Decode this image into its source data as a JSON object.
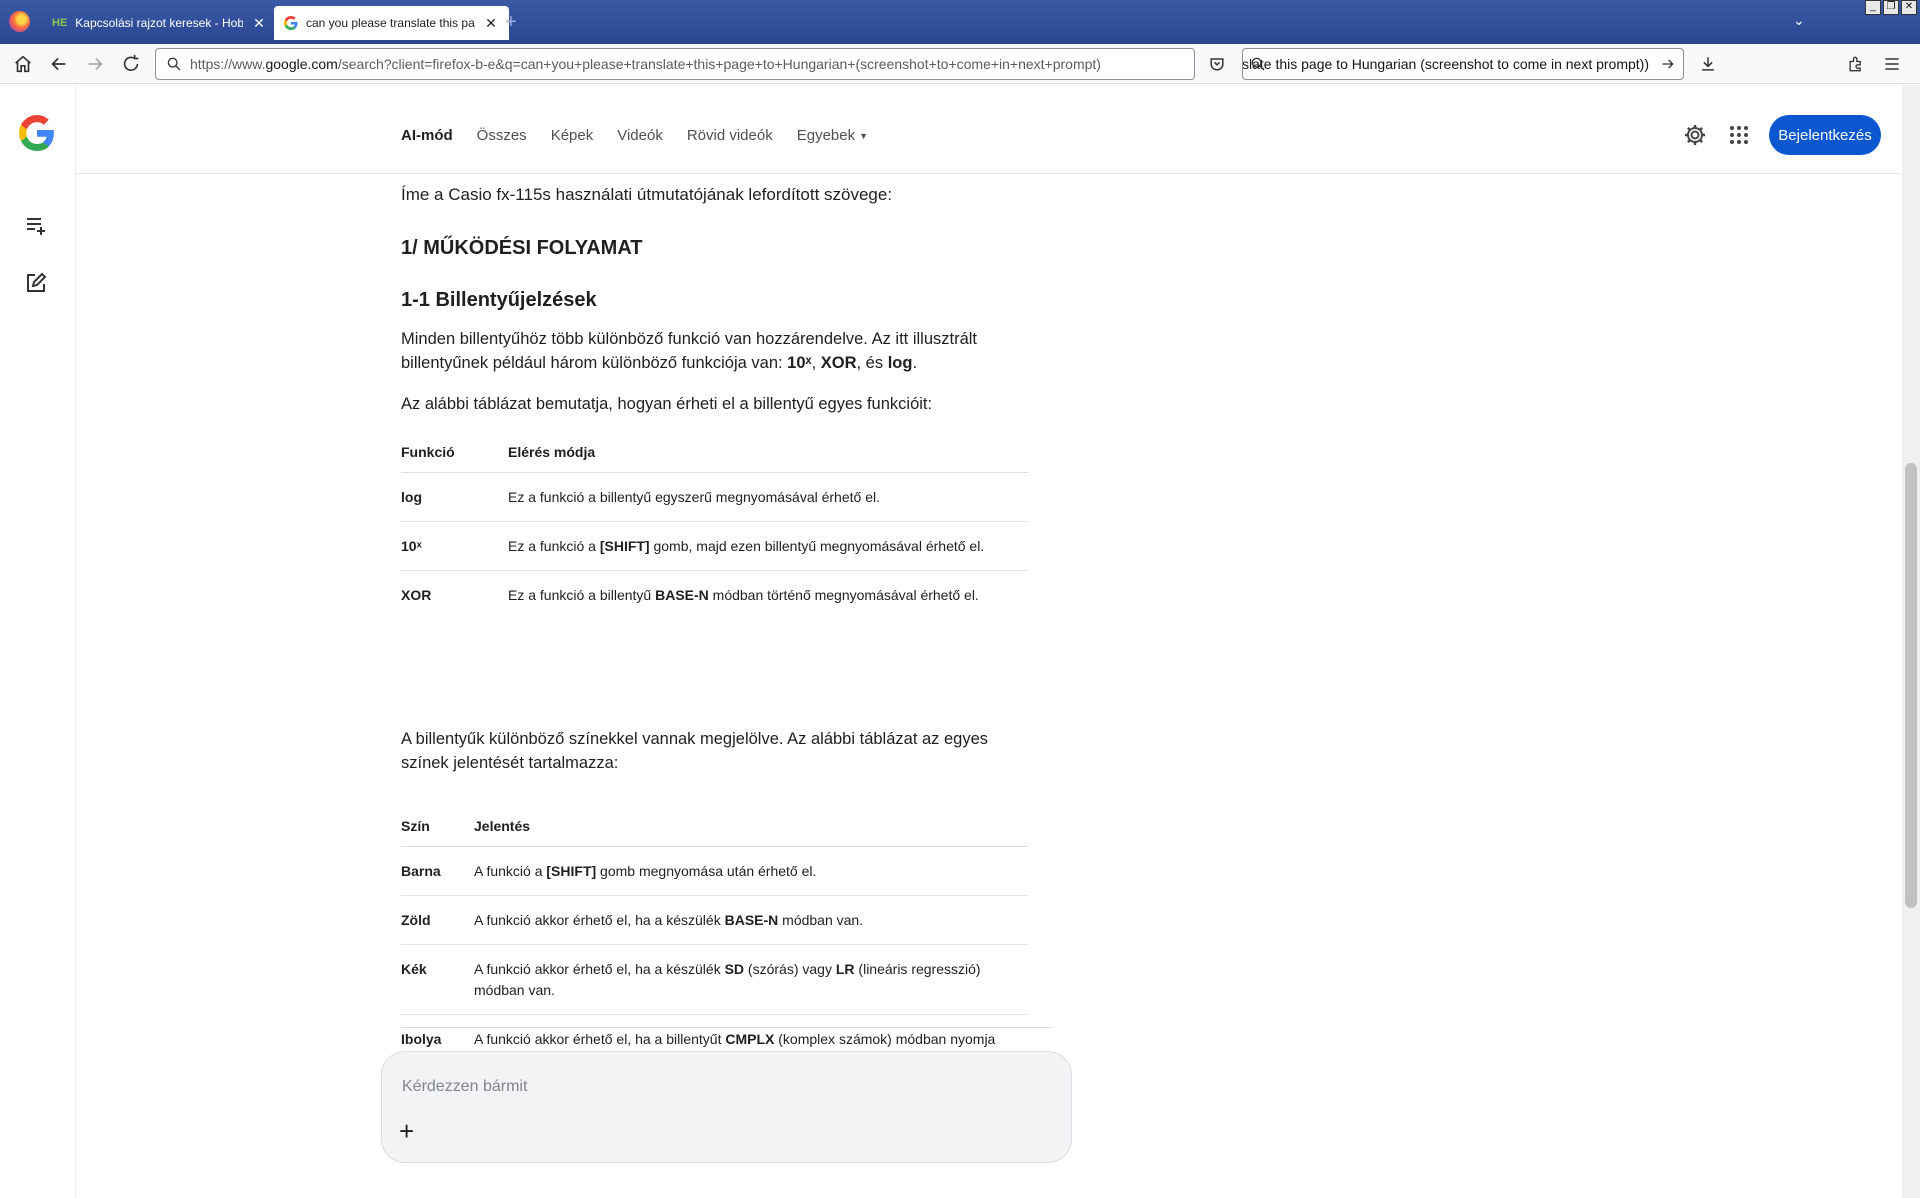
{
  "browser": {
    "tabs": [
      {
        "title": "Kapcsolási rajzot keresek - Hobbielektronika",
        "favicon": "HE",
        "active": false
      },
      {
        "title": "can you please translate this page to Hungarian",
        "favicon": "google-icon",
        "active": true
      }
    ],
    "url_prefix": "https://www.",
    "url_host": "google.com",
    "url_path": "/search?client=firefox-b-e&q=can+you+please+translate+this+page+to+Hungarian+(screenshot+to+come+in+next+prompt)",
    "search_value": "can you please translate this page to Hungarian (screenshot to come in next prompt))"
  },
  "google": {
    "nav": [
      {
        "label": "AI-mód",
        "active": true
      },
      {
        "label": "Összes",
        "active": false
      },
      {
        "label": "Képek",
        "active": false
      },
      {
        "label": "Videók",
        "active": false
      },
      {
        "label": "Rövid videók",
        "active": false
      },
      {
        "label": "Egyebek",
        "active": false
      }
    ],
    "signin_label": "Bejelentkezés",
    "ask_placeholder": "Kérdezzen bármit"
  },
  "answer": {
    "intro": "Íme a Casio fx-115s használati útmutatójának lefordított szövege:",
    "h2": "1/ MŰKÖDÉSI FOLYAMAT",
    "h3": "1-1 Billentyűjelzések",
    "p1_a": "Minden billentyűhöz több különböző funkció van hozzárendelve. Az itt illusztrált billentyűnek például három különböző funkciója van: ",
    "p1_b": "10ˣ",
    "p1_c": ", ",
    "p1_d": "XOR",
    "p1_e": ", és ",
    "p1_f": "log",
    "p1_g": ".",
    "p2": "Az alábbi táblázat bemutatja, hogyan érheti el a billentyű egyes funkcióit:",
    "table1": {
      "headers": [
        "Funkció",
        "Elérés módja"
      ],
      "rows": [
        {
          "k": "log",
          "a": "Ez a funkció a billentyű egyszerű megnyomásával érhető el.",
          "b": "",
          "c": ""
        },
        {
          "k": "10ˣ",
          "a": "Ez a funkció a ",
          "b": "[SHIFT]",
          "c": " gomb, majd ezen billentyű megnyomásával érhető el."
        },
        {
          "k": "XOR",
          "a": "Ez a funkció a billentyű ",
          "b": "BASE-N",
          "c": " módban történő megnyomásával érhető el."
        }
      ]
    },
    "p3": "A billentyűk különböző színekkel vannak megjelölve. Az alábbi táblázat az egyes színek jelentését tartalmazza:",
    "table2": {
      "headers": [
        "Szín",
        "Jelentés"
      ],
      "rows": [
        {
          "k": "Barna",
          "a": "A funkció a ",
          "b": "[SHIFT]",
          "c": " gomb megnyomása után érhető el.",
          "d": "",
          "e": ""
        },
        {
          "k": "Zöld",
          "a": "A funkció akkor érhető el, ha a készülék ",
          "b": "BASE-N",
          "c": " módban van.",
          "d": "",
          "e": ""
        },
        {
          "k": "Kék",
          "a": "A funkció akkor érhető el, ha a készülék ",
          "b": "SD",
          "c": " (szórás) vagy ",
          "d": "LR",
          "e": " (lineáris regresszió) módban van."
        },
        {
          "k": "Ibolya",
          "a": "A funkció akkor érhető el, ha a billentyűt ",
          "b": "CMPLX",
          "c": " (komplex számok) módban nyomja meg.",
          "d": "",
          "e": ""
        }
      ]
    }
  }
}
